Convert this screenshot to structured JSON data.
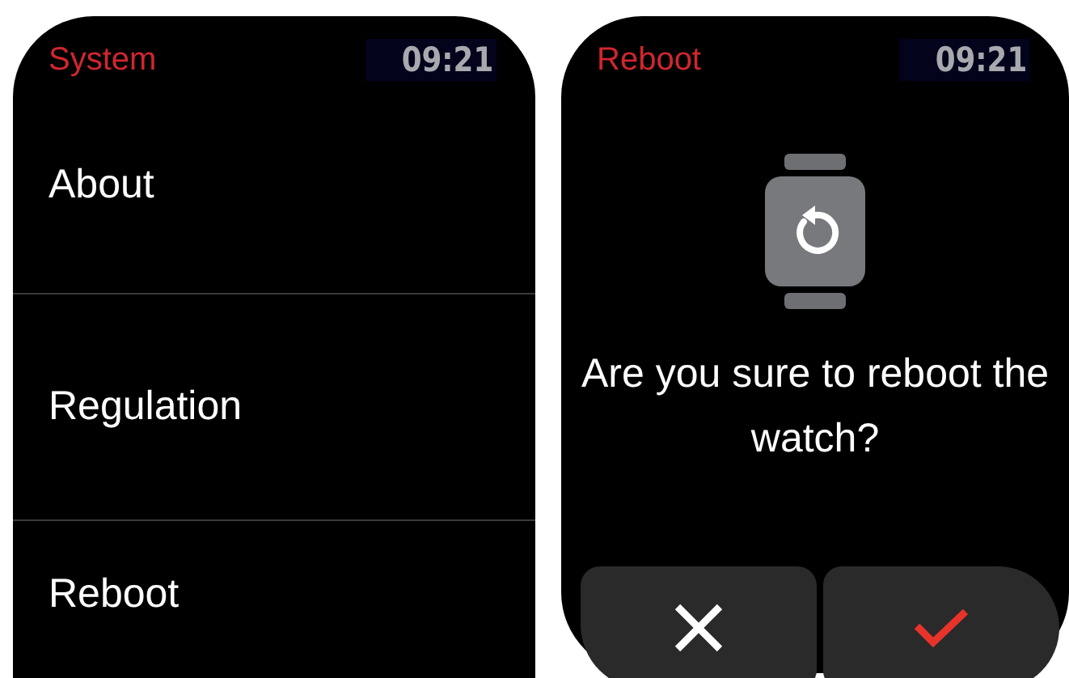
{
  "screens": [
    {
      "kind": "menu",
      "header": {
        "title": "System",
        "time": "09:21"
      },
      "items": [
        "About",
        "Regulation",
        "Reboot"
      ]
    },
    {
      "kind": "confirm",
      "header": {
        "title": "Reboot",
        "time": "09:21"
      },
      "message": "Are you sure to reboot the watch?",
      "buttons": [
        {
          "kind": "cancel"
        },
        {
          "kind": "confirm"
        }
      ]
    }
  ]
}
